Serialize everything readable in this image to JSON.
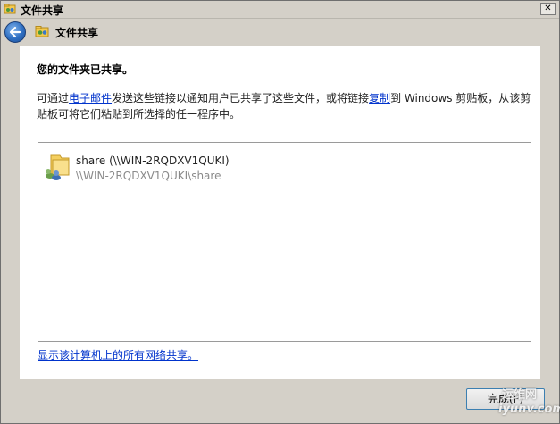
{
  "window": {
    "title": "文件共享"
  },
  "titlebar": {
    "close_label": "✕"
  },
  "nav": {
    "title": "文件共享"
  },
  "content": {
    "heading": "您的文件夹已共享。",
    "desc_prefix": "可通过",
    "email_link": "电子邮件",
    "desc_middle": "发送这些链接以通知用户已共享了这些文件，或将链接",
    "copy_link": "复制",
    "desc_suffix": "到 Windows 剪贴板，从该剪贴板可将它们粘贴到所选择的任一程序中。",
    "share": {
      "name": "share (\\\\WIN-2RQDXV1QUKI)",
      "path": "\\\\WIN-2RQDXV1QUKI\\share"
    },
    "show_all_link": "显示该计算机上的所有网络共享。"
  },
  "footer": {
    "finish_label": "完成(F)"
  },
  "watermark": {
    "top": "运维网",
    "bottom": "iyunv.com"
  }
}
